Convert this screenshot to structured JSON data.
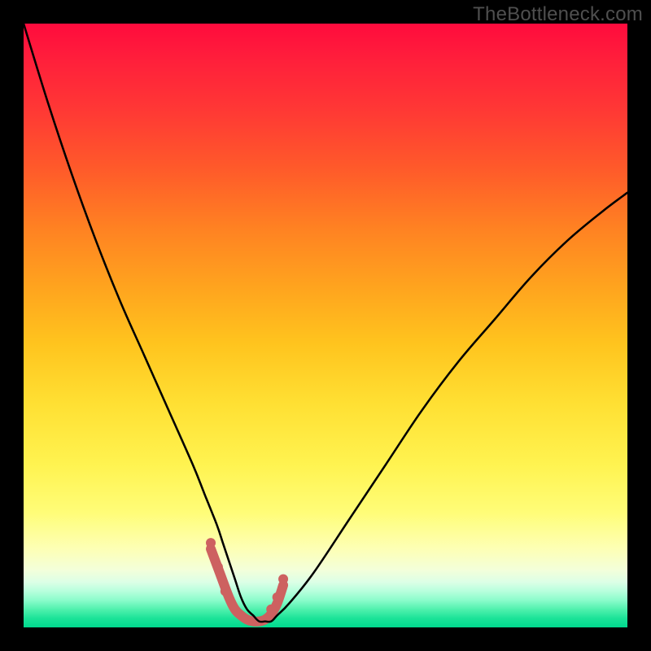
{
  "watermark": "TheBottleneck.com",
  "chart_data": {
    "type": "line",
    "title": "",
    "xlabel": "",
    "ylabel": "",
    "xlim": [
      0,
      100
    ],
    "ylim": [
      0,
      100
    ],
    "grid": false,
    "legend": false,
    "background": {
      "type": "vertical-gradient",
      "stops": [
        {
          "pct": 0,
          "color": "#ff0b3d"
        },
        {
          "pct": 50,
          "color": "#ffc41e"
        },
        {
          "pct": 85,
          "color": "#fdffb5"
        },
        {
          "pct": 100,
          "color": "#00d98e"
        }
      ]
    },
    "series": [
      {
        "name": "bottleneck-curve",
        "color": "#000000",
        "stroke_width": 2,
        "x": [
          0,
          4,
          8,
          12,
          16,
          20,
          24,
          28,
          30,
          32,
          33,
          34,
          35,
          36,
          37,
          38,
          39,
          40,
          41,
          42,
          44,
          48,
          54,
          60,
          66,
          72,
          78,
          84,
          90,
          96,
          100
        ],
        "y": [
          100,
          87,
          75,
          64,
          54,
          45,
          36,
          27,
          22,
          17,
          14,
          11,
          8,
          5,
          3,
          2,
          1,
          1,
          1,
          2,
          4,
          9,
          18,
          27,
          36,
          44,
          51,
          58,
          64,
          69,
          72
        ]
      },
      {
        "name": "optimal-range-marker",
        "color": "#cd6160",
        "stroke_width": 12,
        "x": [
          31,
          32.5,
          34,
          35,
          36,
          37,
          38,
          39,
          40,
          41,
          42,
          43
        ],
        "y": [
          13,
          9,
          5,
          3,
          2,
          1.3,
          1,
          1,
          1.3,
          2.2,
          4,
          7
        ]
      }
    ],
    "markers": [
      {
        "name": "left-dot-1",
        "x": 31,
        "y": 14,
        "r": 6,
        "color": "#cd6160"
      },
      {
        "name": "left-dot-2",
        "x": 32.2,
        "y": 10,
        "r": 6,
        "color": "#cd6160"
      },
      {
        "name": "left-dot-3",
        "x": 33.4,
        "y": 6,
        "r": 6,
        "color": "#cd6160"
      },
      {
        "name": "right-dot-1",
        "x": 41,
        "y": 3,
        "r": 6,
        "color": "#cd6160"
      },
      {
        "name": "right-dot-2",
        "x": 42,
        "y": 5,
        "r": 6,
        "color": "#cd6160"
      },
      {
        "name": "right-dot-3",
        "x": 43,
        "y": 8,
        "r": 6,
        "color": "#cd6160"
      }
    ]
  }
}
